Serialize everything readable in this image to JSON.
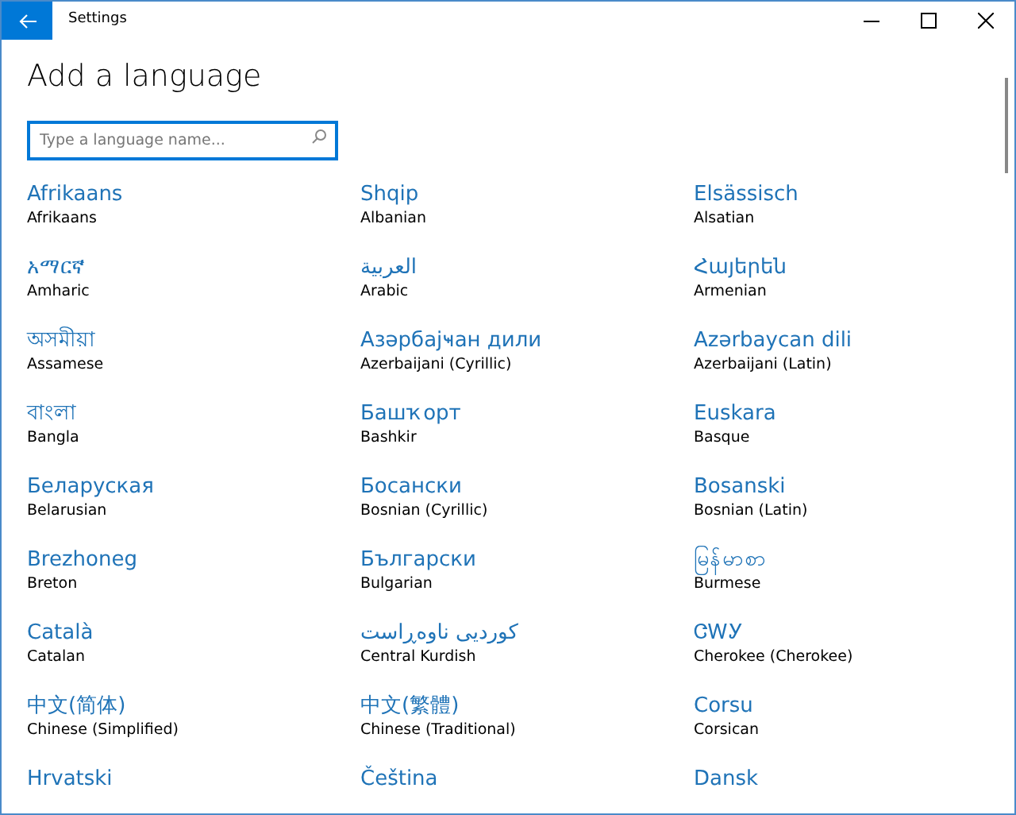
{
  "window": {
    "title": "Settings"
  },
  "page_title": "Add a language",
  "search": {
    "placeholder": "Type a language name..."
  },
  "languages": [
    {
      "native": "Afrikaans",
      "english": "Afrikaans"
    },
    {
      "native": "Shqip",
      "english": "Albanian"
    },
    {
      "native": "Elsässisch",
      "english": "Alsatian"
    },
    {
      "native": "አማርኛ",
      "english": "Amharic"
    },
    {
      "native": "العربية",
      "english": "Arabic"
    },
    {
      "native": "Հայերեն",
      "english": "Armenian"
    },
    {
      "native": "অসমীয়া",
      "english": "Assamese"
    },
    {
      "native": "Азәрбајҹан дили",
      "english": "Azerbaijani (Cyrillic)"
    },
    {
      "native": "Azərbaycan dili",
      "english": "Azerbaijani (Latin)"
    },
    {
      "native": "বাংলা",
      "english": "Bangla"
    },
    {
      "native": "Башҡорт",
      "english": "Bashkir"
    },
    {
      "native": "Euskara",
      "english": "Basque"
    },
    {
      "native": "Беларуская",
      "english": "Belarusian"
    },
    {
      "native": "Босански",
      "english": "Bosnian (Cyrillic)"
    },
    {
      "native": "Bosanski",
      "english": "Bosnian (Latin)"
    },
    {
      "native": "Brezhoneg",
      "english": "Breton"
    },
    {
      "native": "Български",
      "english": "Bulgarian"
    },
    {
      "native": "မြန်မာစာ",
      "english": "Burmese"
    },
    {
      "native": "Català",
      "english": "Catalan"
    },
    {
      "native": "کوردیی ناوەڕاست",
      "english": "Central Kurdish"
    },
    {
      "native": "ᏣᎳᎩ",
      "english": "Cherokee (Cherokee)"
    },
    {
      "native": "中文(简体)",
      "english": "Chinese (Simplified)"
    },
    {
      "native": "中文(繁體)",
      "english": "Chinese (Traditional)"
    },
    {
      "native": "Corsu",
      "english": "Corsican"
    },
    {
      "native": "Hrvatski"
    },
    {
      "native": "Čeština"
    },
    {
      "native": "Dansk"
    }
  ]
}
